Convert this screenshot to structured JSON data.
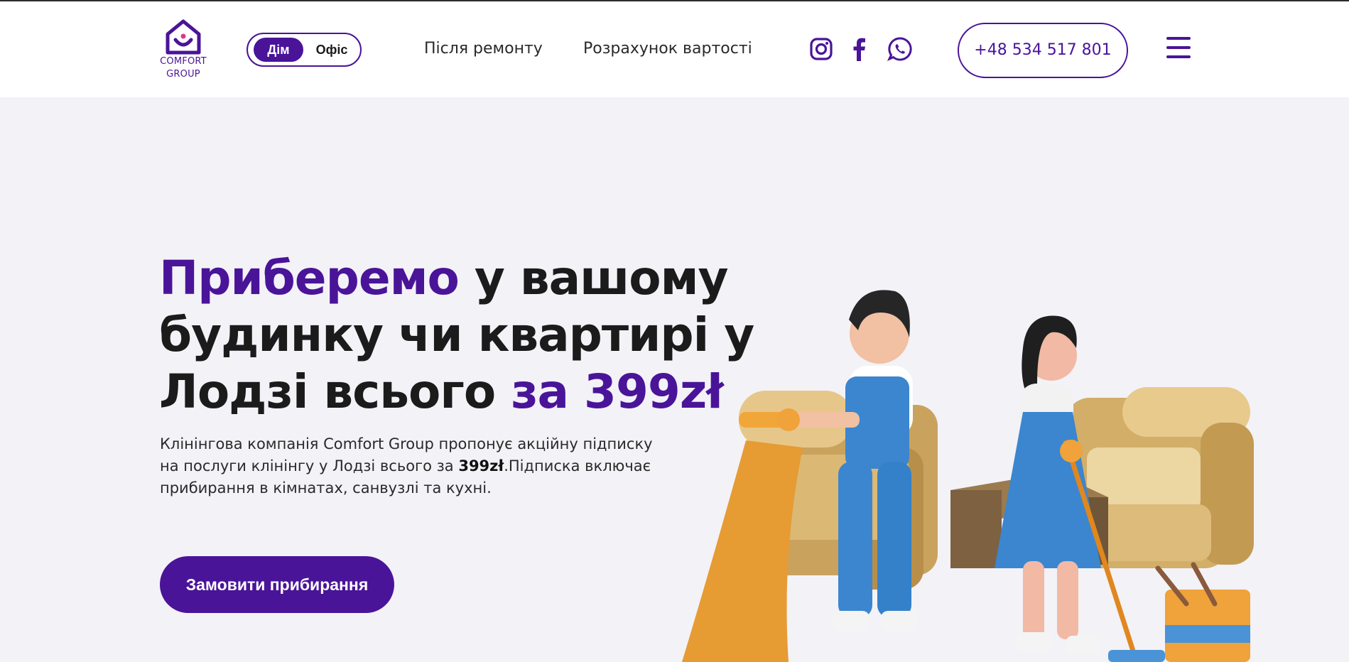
{
  "header": {
    "logo": {
      "line1": "COMFORT",
      "line2": "GROUP",
      "icon": "house-smile-logo"
    },
    "toggle": {
      "home": "Дім",
      "office": "Офіс",
      "selected": "Дім"
    },
    "nav": [
      {
        "label": "Після ремонту"
      },
      {
        "label": "Розрахунок вартості"
      }
    ],
    "social": [
      {
        "icon": "instagram-icon"
      },
      {
        "icon": "facebook-icon"
      },
      {
        "icon": "whatsapp-icon"
      }
    ],
    "phone": "+48 534 517 801",
    "menu_icon": "hamburger-menu-icon"
  },
  "hero": {
    "title_accent": "Приберемо",
    "title_main": " у вашому будинку чи квартирі у Лодзі всього ",
    "title_price": "за 399zł",
    "desc_before": "Клінінгова компанія Comfort Group пропонує акційну підписку на послуги клінінгу у Лодзі всього за ",
    "desc_bold": "399zł",
    "desc_after": ".Підписка включає прибирання в кімнатах, санвузлі та кухні.",
    "cta": "Замовити прибирання"
  },
  "colors": {
    "accent": "#4a1499",
    "background": "#f3f2f7",
    "header_bg": "#ffffff"
  }
}
